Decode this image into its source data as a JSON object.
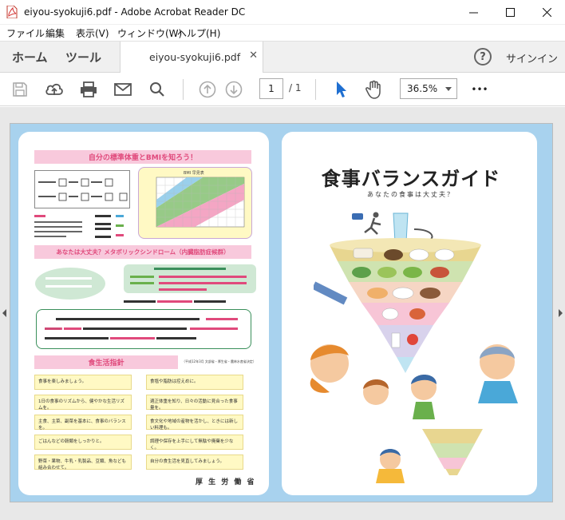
{
  "window": {
    "title": "eiyou-syokuji6.pdf - Adobe Acrobat Reader DC"
  },
  "menu": {
    "items": [
      "ファイル",
      "編集",
      "表示(V)",
      "ウィンドウ(W)",
      "ヘルプ(H)"
    ]
  },
  "tabs": {
    "home": "ホーム",
    "tools": "ツール",
    "document": "eiyou-syokuji6.pdf",
    "signin": "サインイン",
    "help": "?"
  },
  "toolbar": {
    "page_current": "1",
    "page_total": "/ 1",
    "zoom": "36.5%",
    "more": "•••"
  },
  "document": {
    "left": {
      "heading1": "自分の標準体重とBMIを知ろう！",
      "heading2": "あなたは大丈夫？メタボリックシンドローム（内臓脂肪症候群）",
      "heading3": "食生活指針",
      "bmi_chart_title": "BMI 早見表",
      "ministry_small": "（平成12年3月 文部省・厚生省・農林水産省決定）",
      "tips": [
        "食事を楽しみましょう。",
        "1日の食事のリズムから、健やかな生活リズムを。",
        "主食、主菜、副菜を基本に、食事のバランスを。",
        "ごはんなどの穀類をしっかりと。",
        "野菜・果物、牛乳・乳製品、豆類、魚なども組み合わせて。",
        "食塩や脂肪は控えめに。",
        "適正体重を知り、日々の活動に見合った食事量を。",
        "食文化や地域の産物を活かし、ときには新しい料理も。",
        "調理や保存を上手にして無駄や廃棄を少なく。",
        "自分の食生活を見直してみましょう。"
      ],
      "ministry": "厚 生 労 働 省"
    },
    "right": {
      "title": "食事バランスガイド",
      "subtitle": "あなたの食事は大丈夫？"
    }
  }
}
